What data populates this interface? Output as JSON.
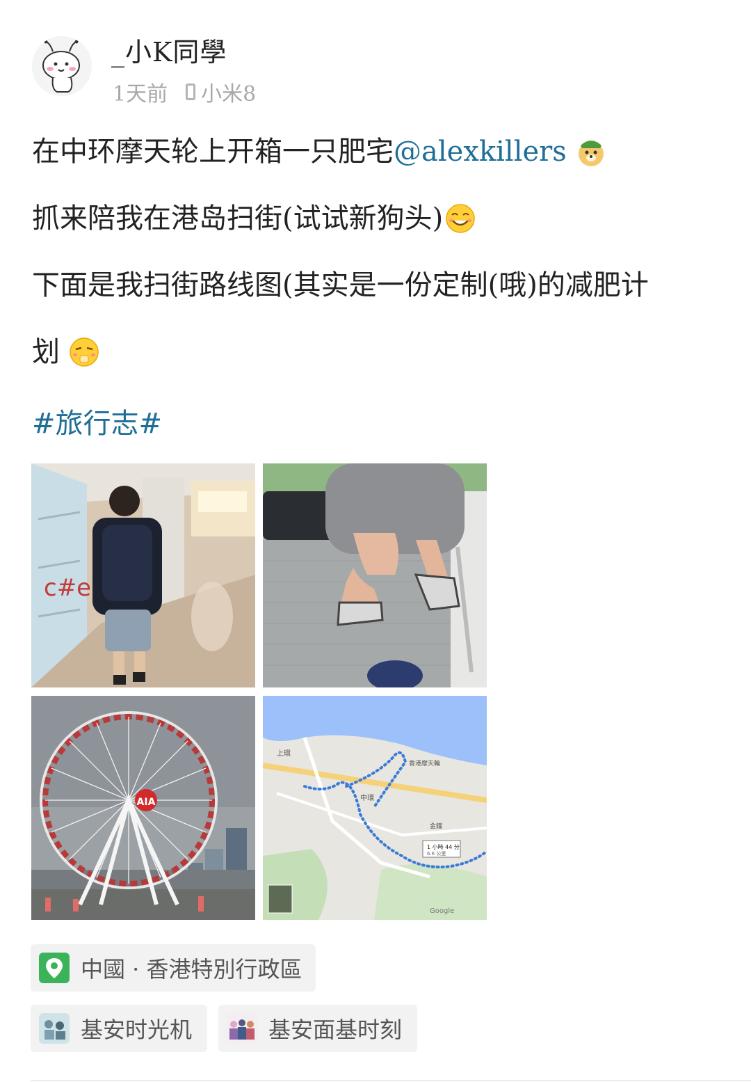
{
  "user": {
    "name": "_小K同學",
    "time": "1天前",
    "device": "小米8"
  },
  "post": {
    "line1": "在中环摩天轮上开箱一只肥宅",
    "mention": "@alexkillers",
    "line2": "抓来陪我在港岛扫街(试试新狗头)",
    "line3": "下面是我扫街路线图(其实是一份定制(哦)的减肥计",
    "line4": "划",
    "topic": "#旅行志#"
  },
  "map": {
    "duration": "1 小時 44 分",
    "distance": "6.6 公里",
    "labels": [
      "上環",
      "中環",
      "香港摩天輪",
      "金鐘",
      "Google"
    ],
    "sign": "AIA"
  },
  "chips": {
    "location": "中國 · 香港特別行政區",
    "tag_a": "基安时光机",
    "tag_b": "基安面基时刻"
  },
  "colors": {
    "link": "#1f6e96",
    "chip_bg": "#f2f2f2",
    "location_green": "#3bb35a"
  },
  "icons": [
    "avatar-cartoon",
    "phone-icon",
    "doge-emoji",
    "grin-emoji",
    "sneaky-emoji",
    "location-pin-icon",
    "tag-thumbnail"
  ]
}
